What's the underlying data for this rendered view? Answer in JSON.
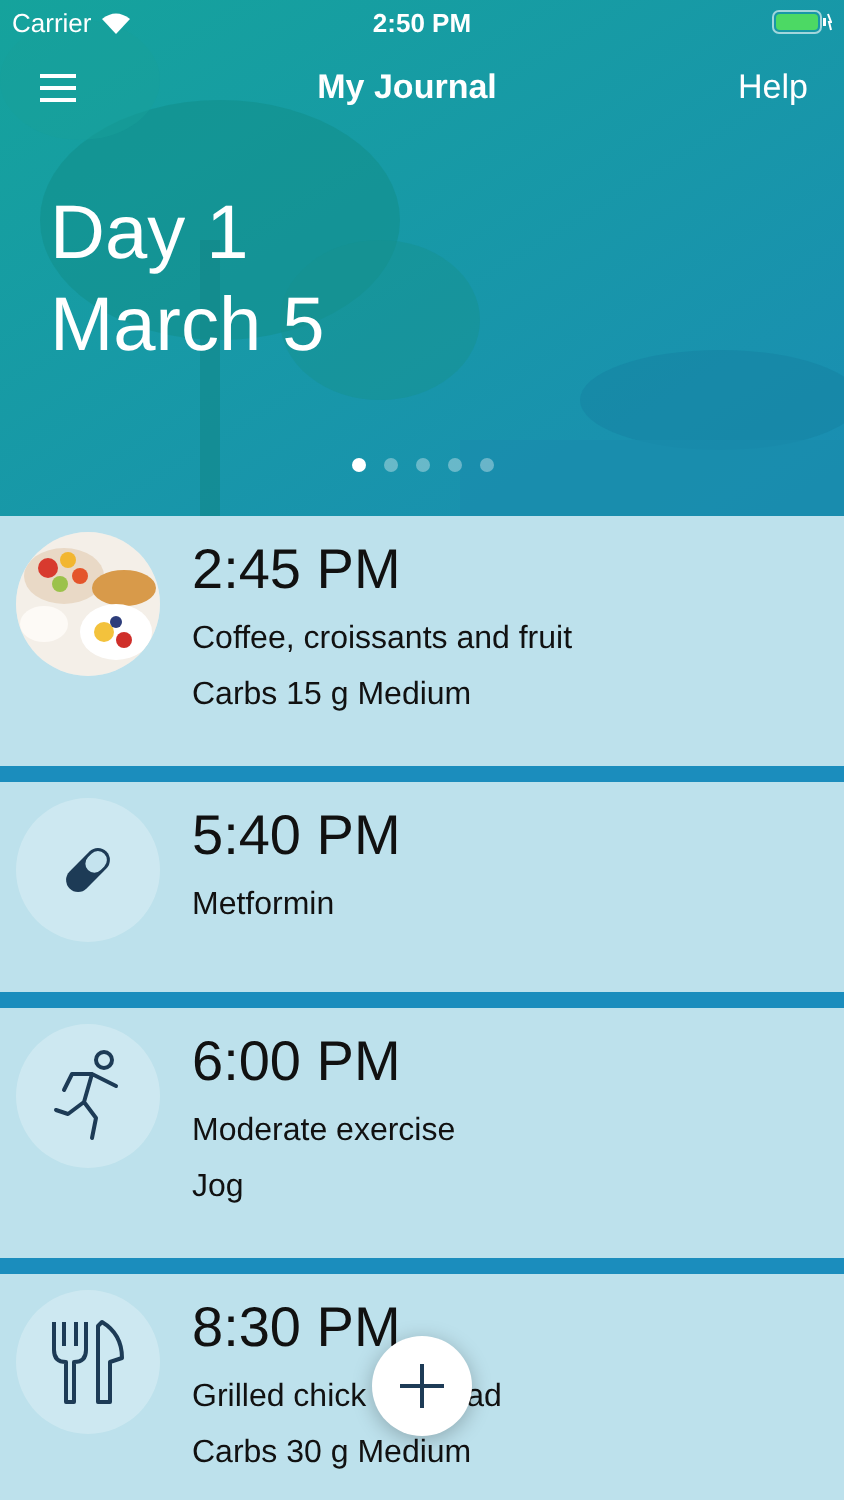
{
  "status_bar": {
    "carrier": "Carrier",
    "time": "2:50 PM"
  },
  "nav": {
    "title": "My Journal",
    "help": "Help"
  },
  "header": {
    "day": "Day 1",
    "date": "March 5"
  },
  "pages": [
    {
      "selected": true
    },
    {
      "selected": false
    },
    {
      "selected": false
    },
    {
      "selected": false
    },
    {
      "selected": false
    }
  ],
  "entries": [
    {
      "time": "2:45 PM",
      "lines": [
        [
          "Coffee, croissants and fruit"
        ],
        [
          "Carbs 15 g Medium"
        ]
      ]
    },
    {
      "kind": "pill",
      "time": "5:40 PM",
      "lines": [
        [
          "Metformin"
        ]
      ]
    },
    {
      "kind": "exercise",
      "time": "6:00 PM",
      "lines": [
        [
          "Moderate exercise"
        ],
        [
          "Jog"
        ]
      ]
    },
    {
      "kind": "meal",
      "time": "8:30 PM",
      "lines": [
        [
          "Grilled chick",
          "ad"
        ],
        [
          "Carbs 30 g Medium"
        ]
      ]
    }
  ]
}
